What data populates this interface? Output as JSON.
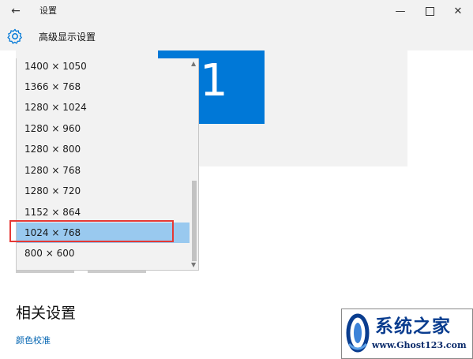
{
  "titlebar": {
    "back_icon": "←",
    "title": "设置",
    "minimize_icon": "—",
    "close_icon": "✕"
  },
  "header": {
    "title": "高级显示设置",
    "icon": "gear-icon"
  },
  "preview": {
    "monitor_number": "1",
    "accent": "#0078d7"
  },
  "resolution_dropdown": {
    "items": [
      "1400 × 1050",
      "1366 × 768",
      "1280 × 1024",
      "1280 × 960",
      "1280 × 800",
      "1280 × 768",
      "1280 × 720",
      "1152 × 864",
      "1024 × 768",
      "800 × 600"
    ],
    "selected": "1024 × 768"
  },
  "related": {
    "title": "相关设置",
    "link": "颜色校准"
  },
  "watermark": {
    "brand": "系统之家",
    "url": "www.Ghost123.com"
  }
}
